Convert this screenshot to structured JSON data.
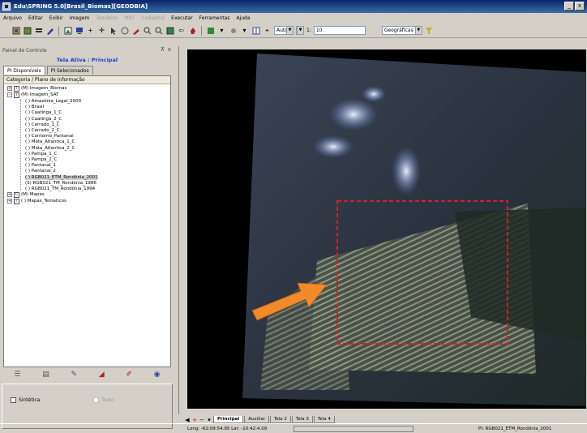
{
  "window": {
    "title": "Edu\\SPRING 5.0[Brasil_Biomas][GEODBIA]",
    "minimize_label": "_",
    "close_label": "x"
  },
  "menu": {
    "items": [
      {
        "label": "Arquivo",
        "enabled": true
      },
      {
        "label": "Editar",
        "enabled": true
      },
      {
        "label": "Exibir",
        "enabled": true
      },
      {
        "label": "Imagem",
        "enabled": true
      },
      {
        "label": "Temático",
        "enabled": false
      },
      {
        "label": "MNT",
        "enabled": false
      },
      {
        "label": "Cadastral",
        "enabled": false
      },
      {
        "label": "Executar",
        "enabled": true
      },
      {
        "label": "Ferramentas",
        "enabled": true
      },
      {
        "label": "Ajuda",
        "enabled": true
      }
    ]
  },
  "toolbar": {
    "zoom_mode": "Auto",
    "scale_prefix": "1:",
    "scale_value": "10",
    "coord_system": "Geográficas"
  },
  "left_panel": {
    "title": "Painel de Controle",
    "pin_icon": "pin-icon",
    "close_label": "x",
    "active_view": "Tela Ativa : Principal",
    "tabs": [
      {
        "label": "PI Disponíveis",
        "active": true
      },
      {
        "label": "PI Selecionados",
        "active": false
      }
    ],
    "tree_header": "Categoria / Plano de Informação",
    "tree": [
      {
        "label": "(M) Imagem_Biomas",
        "level": 0,
        "expander": "+",
        "icon": "I"
      },
      {
        "label": "(M) Imagem_SAT",
        "level": 0,
        "expander": "-",
        "icon": "I"
      },
      {
        "label": "( ) Amazônia_Legal_2000",
        "level": 1
      },
      {
        "label": "( ) Brasil",
        "level": 1
      },
      {
        "label": "( ) Caatinga_1_C",
        "level": 1
      },
      {
        "label": "( ) Caatinga_2_C",
        "level": 1
      },
      {
        "label": "( ) Cerrado_1_C",
        "level": 1
      },
      {
        "label": "( ) Cerrado_2_C",
        "level": 1
      },
      {
        "label": "( ) Contorno_Pantanal",
        "level": 1
      },
      {
        "label": "( ) Mata_Atlantica_1_C",
        "level": 1
      },
      {
        "label": "( ) Mata_Atlantica_2_C",
        "level": 1
      },
      {
        "label": "( ) Pampa_1_C",
        "level": 1
      },
      {
        "label": "( ) Pampa_2_C",
        "level": 1
      },
      {
        "label": "( ) Pantanal_1",
        "level": 1
      },
      {
        "label": "( ) Pantanal_2",
        "level": 1
      },
      {
        "label": "( ) RGB021_ETM_Rondônia_2001",
        "level": 1,
        "selected": true
      },
      {
        "label": "(S) RGB021_TM_Rondônia_1986",
        "level": 1
      },
      {
        "label": "( ) RGB021_TM_Rondônia_1994",
        "level": 1
      },
      {
        "label": "(M) Mapas",
        "level": 0,
        "expander": "+",
        "icon": "C"
      },
      {
        "label": "( ) Mapas_Tematicos",
        "level": 0,
        "expander": "+",
        "icon": "T"
      }
    ],
    "checkboxes": [
      {
        "label": "Sintética",
        "checked": false,
        "enabled": true
      },
      {
        "label": "Texto",
        "checked": false,
        "enabled": false
      }
    ]
  },
  "view_tabs": [
    "Principal",
    "Auxiliar",
    "Tela 2",
    "Tela 3",
    "Tela 4"
  ],
  "view_tabs_active": "Principal",
  "status": {
    "coords": "Long: -62:09:54.95 Lat: -10:42:4.09",
    "active_pi": "PI: RGB021_ETM_Rondônia_2001"
  },
  "colors": {
    "highlight_box": "#d0202a",
    "arrow": "#f28a2a",
    "active_view_text": "#1a3ec8",
    "titlebar_start": "#0a246a",
    "titlebar_end": "#3a6ea5"
  }
}
